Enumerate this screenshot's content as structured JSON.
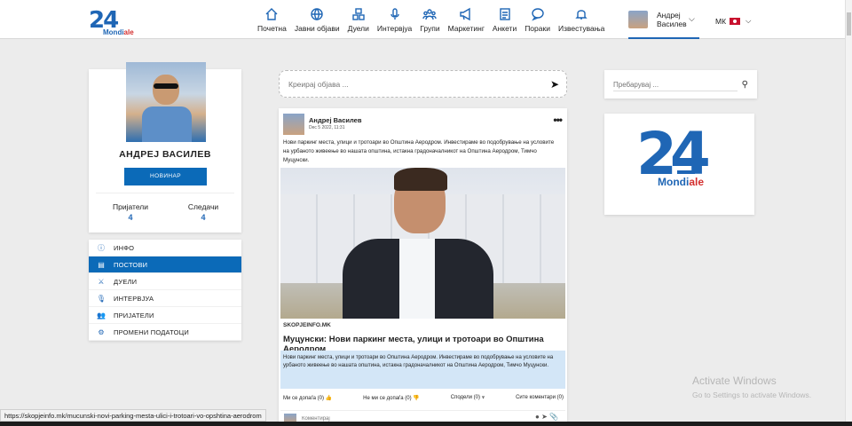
{
  "brand": {
    "number": "24",
    "sub_a": "Mondi",
    "sub_b": "ale"
  },
  "nav": [
    {
      "label": "Почетна",
      "icon": "home-icon"
    },
    {
      "label": "Јавни објави",
      "icon": "globe-icon"
    },
    {
      "label": "Дуели",
      "icon": "duels-icon"
    },
    {
      "label": "Интервјуа",
      "icon": "microphone-icon"
    },
    {
      "label": "Групи",
      "icon": "groups-icon"
    },
    {
      "label": "Маркетинг",
      "icon": "megaphone-icon"
    },
    {
      "label": "Анкети",
      "icon": "poll-icon"
    },
    {
      "label": "Пораки",
      "icon": "message-icon"
    },
    {
      "label": "Известувања",
      "icon": "bell-icon"
    }
  ],
  "user": {
    "first": "Андреј",
    "last": "Василев"
  },
  "lang": {
    "code": "МК"
  },
  "profile": {
    "name": "АНДРЕЈ ВАСИЛЕВ",
    "role": "НОВИНАР",
    "friends_label": "Пријатели",
    "friends_count": "4",
    "followers_label": "Следачи",
    "followers_count": "4"
  },
  "menu": [
    {
      "label": "ИНФО",
      "icon": "info-icon",
      "glyph": "ⓘ"
    },
    {
      "label": "ПОСТОВИ",
      "icon": "posts-icon",
      "glyph": "▤"
    },
    {
      "label": "ДУЕЛИ",
      "icon": "duels-icon",
      "glyph": "⚔"
    },
    {
      "label": "ИНТЕРВЈУА",
      "icon": "microphone-icon",
      "glyph": "🎙"
    },
    {
      "label": "ПРИЈАТЕЛИ",
      "icon": "friends-icon",
      "glyph": "👥"
    },
    {
      "label": "ПРОМЕНИ ПОДАТОЦИ",
      "icon": "gear-icon",
      "glyph": "⚙"
    }
  ],
  "composer": {
    "placeholder": "Креирај објава ..."
  },
  "post": {
    "author": "Андреј Василев",
    "date": "Dec 5 2022, 11:31",
    "text": "Нови паркинг места, улици и тротоари во Општина Аеродром. Инвестираме во подобрување на условите на урбаното живеење во нашата општина, истакна градоначалникот на Општина Аеродром, Тимчо Муцунски.",
    "source": "SKOPJEINFO.MK",
    "title": "Муцунски: Нови паркинг места, улици и тротоари во Општина Аеродром",
    "excerpt": "Нови паркинг места, улици и тротоари во Општина Аеродром. Инвестираме во подобрување на условите на урбаното живеење во нашата општина, истакна градоначалникот на Општина Аеродром, Тимчо Муцунски.",
    "like": "Ми се допаѓа (0)",
    "dislike": "Не ми се допаѓа (0)",
    "share": "Сподели (0)",
    "comments": "Сите коментари (0)",
    "comment_placeholder": "Коментирај"
  },
  "search": {
    "placeholder": "Пребарувај ..."
  },
  "watermark": {
    "line1": "Activate Windows",
    "line2": "Go to Settings to activate Windows."
  },
  "statusbar": {
    "url": "https://skopjeinfo.mk/mucunski-novi-parking-mesta-ulici-i-trotoari-vo-opshtina-aerodrom"
  }
}
